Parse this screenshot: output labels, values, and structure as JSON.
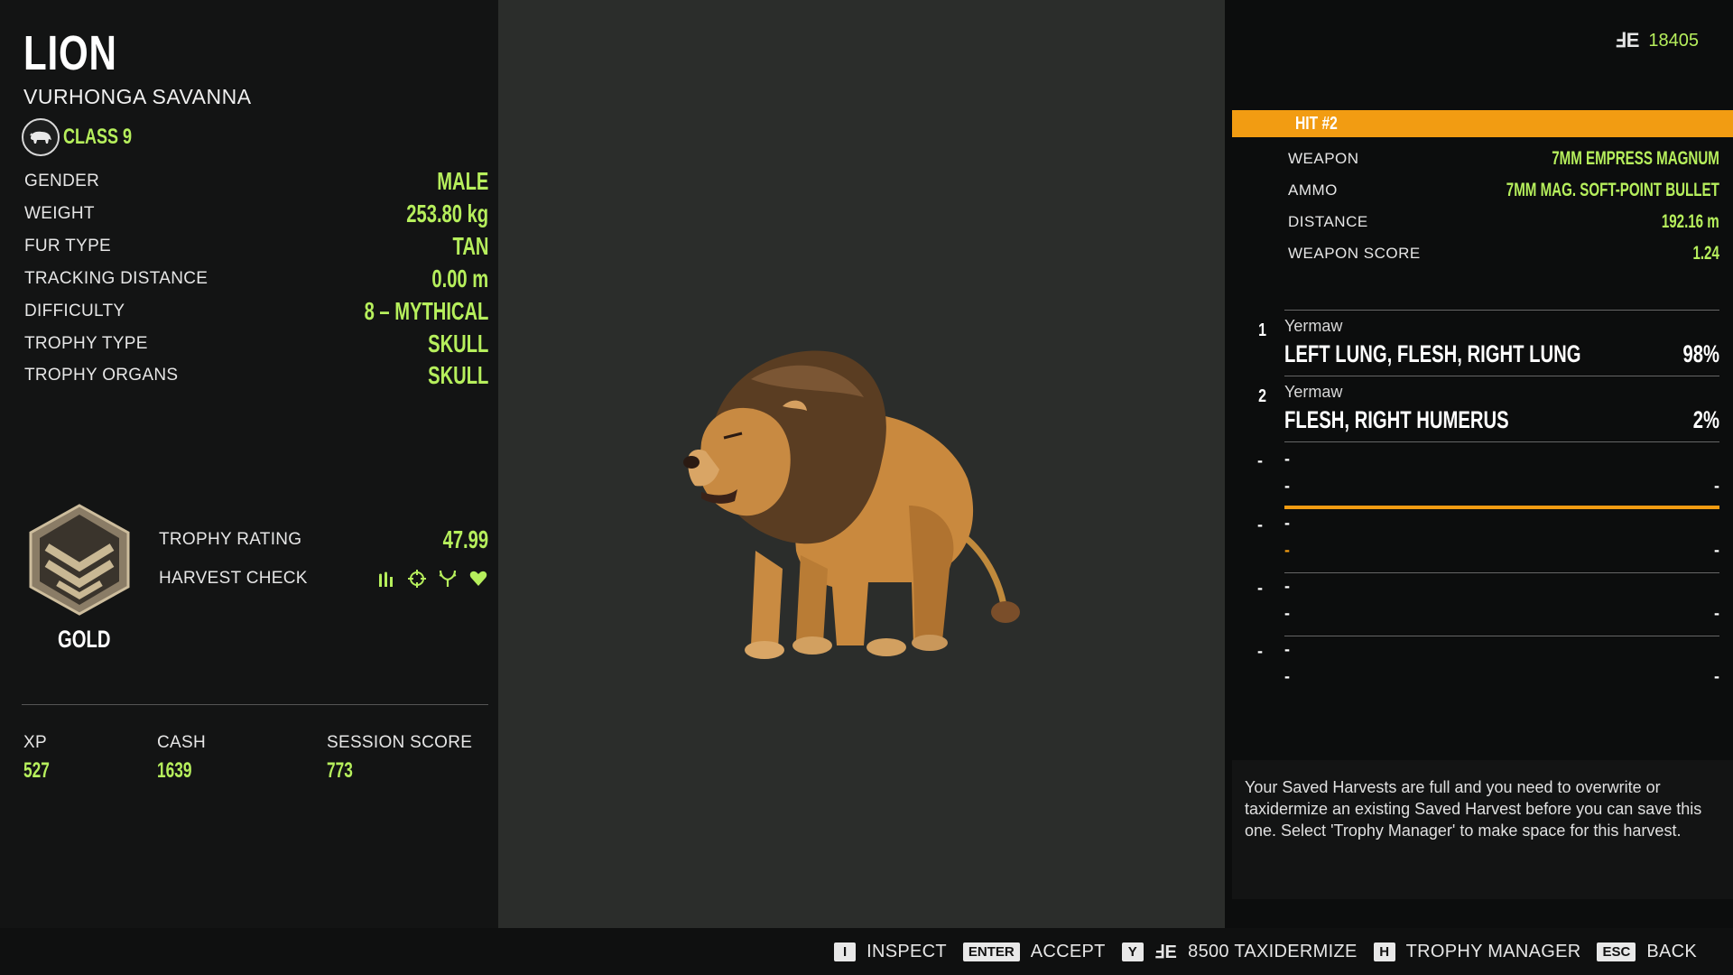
{
  "animal": {
    "name": "LION",
    "region": "VURHONGA SAVANNA",
    "class_label": "CLASS 9",
    "class_icon": "buffalo-icon"
  },
  "stats": [
    {
      "label": "GENDER",
      "value": "MALE"
    },
    {
      "label": "WEIGHT",
      "value": "253.80 kg"
    },
    {
      "label": "FUR TYPE",
      "value": "TAN"
    },
    {
      "label": "TRACKING DISTANCE",
      "value": "0.00 m"
    },
    {
      "label": "DIFFICULTY",
      "value": "8 – MYTHICAL"
    },
    {
      "label": "TROPHY TYPE",
      "value": "SKULL"
    },
    {
      "label": "TROPHY ORGANS",
      "value": "SKULL"
    }
  ],
  "trophy": {
    "badge": "GOLD",
    "rating_label": "TROPHY RATING",
    "rating_value": "47.99",
    "harvest_label": "HARVEST CHECK",
    "harvest_icons": [
      "ammo-icon",
      "crosshair-icon",
      "antlers-icon",
      "heart-icon"
    ]
  },
  "summary": [
    {
      "label": "XP",
      "value": "527"
    },
    {
      "label": "CASH",
      "value": "1639"
    },
    {
      "label": "SESSION SCORE",
      "value": "773"
    }
  ],
  "currency": {
    "symbol": "ℲE",
    "value": "18405"
  },
  "hit": {
    "title": "HIT #2",
    "rows": [
      {
        "label": "WEAPON",
        "value": "7MM EMPRESS MAGNUM"
      },
      {
        "label": "AMMO",
        "value": "7MM MAG. SOFT-POINT BULLET"
      },
      {
        "label": "DISTANCE",
        "value": "192.16 m"
      },
      {
        "label": "WEAPON SCORE",
        "value": "1.24"
      }
    ]
  },
  "results": [
    {
      "num": "1",
      "player": "Yermaw",
      "hits": "LEFT LUNG, FLESH, RIGHT LUNG",
      "pct": "98%"
    },
    {
      "num": "2",
      "player": "Yermaw",
      "hits": "FLESH, RIGHT HUMERUS",
      "pct": "2%"
    }
  ],
  "empty_slots": [
    {
      "dash": "-",
      "highlighted": true
    },
    {
      "dash": "-",
      "highlighted": false
    },
    {
      "dash": "-",
      "highlighted": false
    },
    {
      "dash": "-",
      "highlighted": false
    }
  ],
  "notice": "Your Saved Harvests are full and you need to overwrite or taxidermize an existing Saved Harvest before you can save this one. Select 'Trophy Manager' to make space for this harvest.",
  "controls": [
    {
      "key": "I",
      "label": "INSPECT"
    },
    {
      "key": "ENTER",
      "label": "ACCEPT"
    },
    {
      "key": "Y",
      "label": "8500 TAXIDERMIZE",
      "icon": "currency-icon"
    },
    {
      "key": "H",
      "label": "TROPHY MANAGER"
    },
    {
      "key": "ESC",
      "label": "BACK"
    }
  ],
  "colors": {
    "accent_green": "#b6ef5c",
    "accent_orange": "#f29c12",
    "badge_gold": "#b9a98a"
  }
}
